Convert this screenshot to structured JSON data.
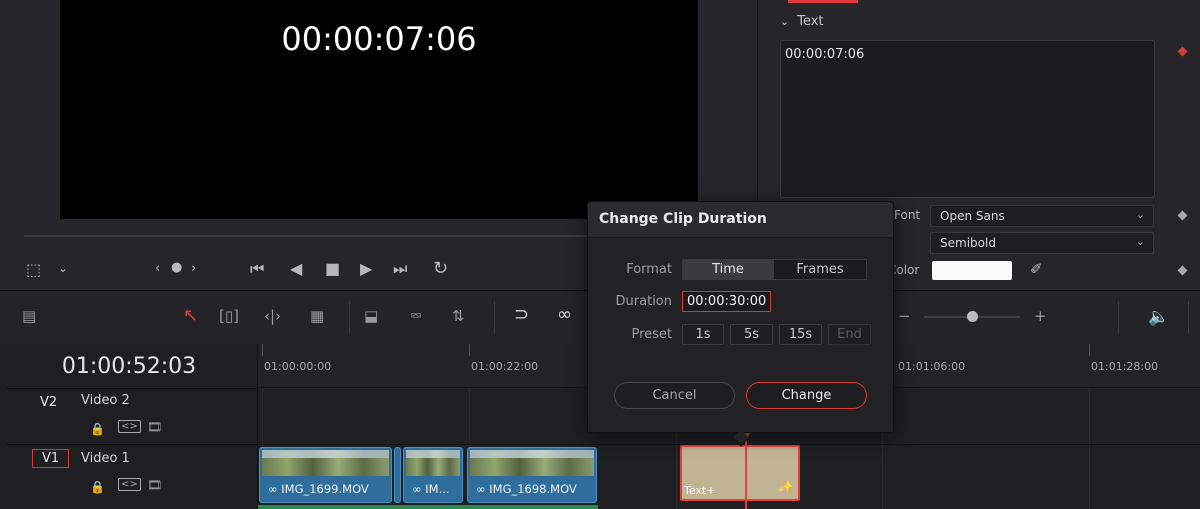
{
  "viewer": {
    "timecode_overlay": "00:00:07:06"
  },
  "inspector": {
    "section_label": "Text",
    "text_value": "00:00:07:06",
    "font_label": "Font",
    "font_value": "Open Sans",
    "style_value": "Semibold",
    "color_label": "Color",
    "accent_color": "#e0393a"
  },
  "timeline": {
    "current_timecode": "01:00:52:03",
    "ruler_labels": [
      "01:00:00:00",
      "01:00:22:00",
      "01:01:06:00",
      "01:01:28:00"
    ],
    "tracks": [
      {
        "id": "V2",
        "name": "Video 2"
      },
      {
        "id": "V1",
        "name": "Video 1"
      }
    ],
    "clips": [
      {
        "label": "IMG_1699.MOV"
      },
      {
        "label": "IM..."
      },
      {
        "label": "IMG_1698.MOV"
      }
    ],
    "text_clip_label": "Text+"
  },
  "dialog": {
    "title": "Change Clip Duration",
    "format_label": "Format",
    "format_options": [
      "Time",
      "Frames"
    ],
    "format_selected": "Time",
    "duration_label": "Duration",
    "duration_value": "00:00:30:00",
    "preset_label": "Preset",
    "presets": [
      "1s",
      "5s",
      "15s",
      "End"
    ],
    "cancel_label": "Cancel",
    "change_label": "Change"
  }
}
